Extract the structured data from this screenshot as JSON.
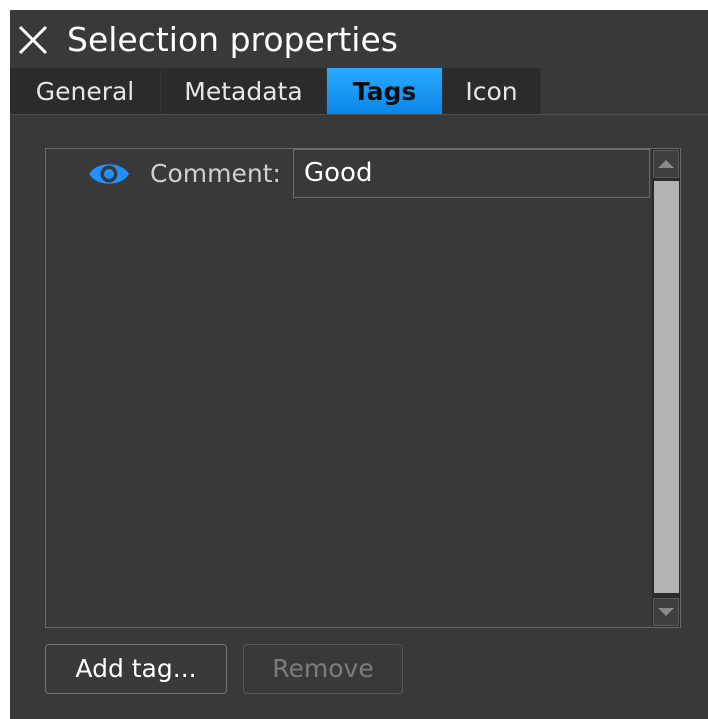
{
  "window": {
    "title": "Selection properties"
  },
  "tabs": [
    {
      "label": "General",
      "active": false
    },
    {
      "label": "Metadata",
      "active": false
    },
    {
      "label": "Tags",
      "active": true
    },
    {
      "label": "Icon",
      "active": false
    }
  ],
  "tags": [
    {
      "icon": "eye-icon",
      "label": "Comment:",
      "value": "Good",
      "visible": true
    }
  ],
  "buttons": {
    "add_label": "Add tag...",
    "remove_label": "Remove",
    "remove_enabled": false
  },
  "colors": {
    "accent": "#0a86e6",
    "background": "#393939",
    "tab_background": "#2b2b2b"
  }
}
